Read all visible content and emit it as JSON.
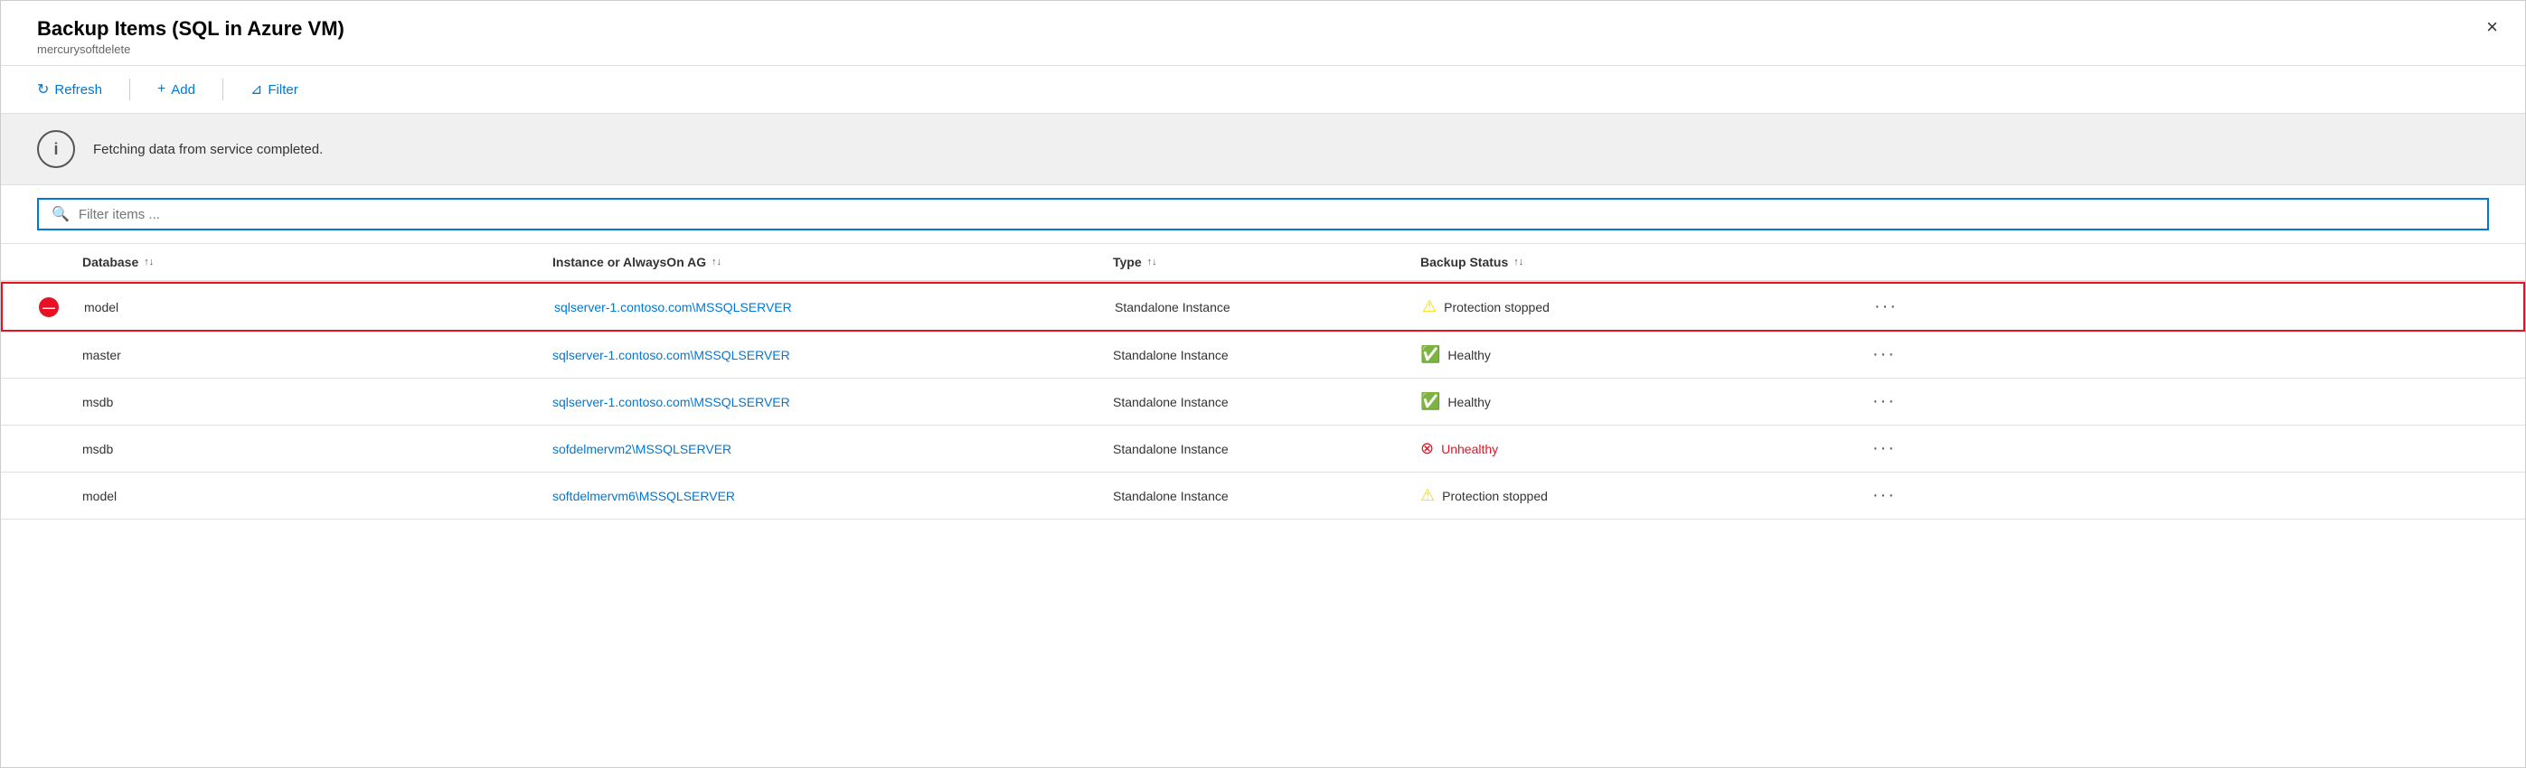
{
  "panel": {
    "title": "Backup Items (SQL in Azure VM)",
    "subtitle": "mercurysoftdelete",
    "close_label": "×"
  },
  "toolbar": {
    "refresh_label": "Refresh",
    "add_label": "Add",
    "filter_label": "Filter"
  },
  "info_banner": {
    "message": "Fetching data from service completed."
  },
  "search": {
    "placeholder": "Filter items ..."
  },
  "table": {
    "columns": [
      {
        "id": "icon",
        "label": ""
      },
      {
        "id": "database",
        "label": "Database",
        "sortable": true
      },
      {
        "id": "instance",
        "label": "Instance or AlwaysOn AG",
        "sortable": true
      },
      {
        "id": "type",
        "label": "Type",
        "sortable": true
      },
      {
        "id": "backup_status",
        "label": "Backup Status",
        "sortable": true
      },
      {
        "id": "actions",
        "label": ""
      }
    ],
    "rows": [
      {
        "highlighted": true,
        "icon": "stop",
        "database": "model",
        "instance": "sqlserver-1.contoso.com\\MSSQLSERVER",
        "type": "Standalone Instance",
        "backup_status_type": "warning",
        "backup_status_text": "Protection stopped",
        "has_more": true
      },
      {
        "highlighted": false,
        "icon": null,
        "database": "master",
        "instance": "sqlserver-1.contoso.com\\MSSQLSERVER",
        "type": "Standalone Instance",
        "backup_status_type": "ok",
        "backup_status_text": "Healthy",
        "has_more": true
      },
      {
        "highlighted": false,
        "icon": null,
        "database": "msdb",
        "instance": "sqlserver-1.contoso.com\\MSSQLSERVER",
        "type": "Standalone Instance",
        "backup_status_type": "ok",
        "backup_status_text": "Healthy",
        "has_more": true
      },
      {
        "highlighted": false,
        "icon": null,
        "database": "msdb",
        "instance": "sofdelmervm2\\MSSQLSERVER",
        "type": "Standalone Instance",
        "backup_status_type": "error",
        "backup_status_text": "Unhealthy",
        "has_more": true
      },
      {
        "highlighted": false,
        "icon": null,
        "database": "model",
        "instance": "softdelmervm6\\MSSQLSERVER",
        "type": "Standalone Instance",
        "backup_status_type": "warning",
        "backup_status_text": "Protection stopped",
        "has_more": true
      }
    ]
  }
}
